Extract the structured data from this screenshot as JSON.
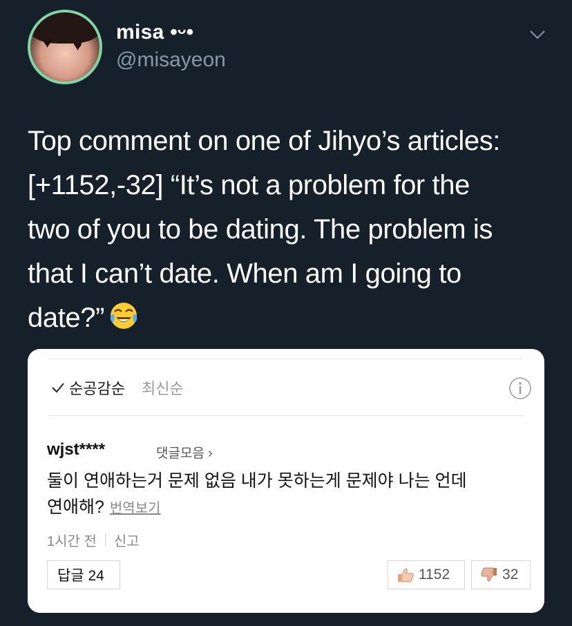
{
  "tweet": {
    "display_name": "misa •ᵕ•",
    "handle": "@misayeon",
    "text_line_1": "Top comment on one of Jihyo’s articles:",
    "text_line_2": "[+1152,-32] “It’s not a problem for the",
    "text_line_3": "two of you to be dating. The problem is",
    "text_line_4": "that I can’t date. When am I going to",
    "text_line_5": "date?”",
    "emoji_icon": "face-with-tears-of-joy-icon"
  },
  "card": {
    "sort_active": "순공감순",
    "sort_inactive": "최신순",
    "comment_user": "wjst****",
    "comment_more": "댓글모음 ›",
    "comment_line_1": "둘이 연애하는거 문제 없음 내가 못하는게 문제야 나는 언데",
    "comment_line_2": "연애해?",
    "translate_label": "번역보기",
    "time": "1시간 전",
    "report": "신고",
    "reply_label": "답글 24",
    "likes": "1152",
    "dislikes": "32"
  },
  "colors": {
    "background": "#15202b",
    "avatar_ring": "#7fd5a3",
    "handle": "#8899a6"
  }
}
